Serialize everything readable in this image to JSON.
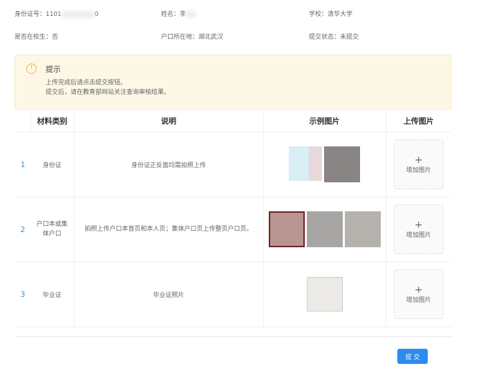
{
  "info": {
    "id_label": "身份证号：1101",
    "id_suffix": "0",
    "name_label": "姓名：李",
    "school": "学校：清华大学",
    "in_school": "是否在校生：否",
    "hukou": "户口所在地：湖北武汉",
    "status": "提交状态：未提交"
  },
  "alert": {
    "title": "提示",
    "line1": "上传完成后请点击提交按钮。",
    "line2": "提交后，请在教育部网站关注查询审核结果。"
  },
  "table": {
    "headers": [
      "",
      "材料类别",
      "说明",
      "示例图片",
      "上传图片"
    ],
    "rows": [
      {
        "index": "1",
        "category": "身份证",
        "description": "身份证正反面均需拍照上传",
        "upload": "增加图片"
      },
      {
        "index": "2",
        "category": "户口本或集体户口",
        "description": "拍照上传户口本首页和本人页；集体户口页上传整页户口页。",
        "upload": "增加图片"
      },
      {
        "index": "3",
        "category": "毕业证",
        "description": "毕业证照片",
        "upload": "增加图片"
      }
    ]
  },
  "plus": "+",
  "submit": "提 交"
}
